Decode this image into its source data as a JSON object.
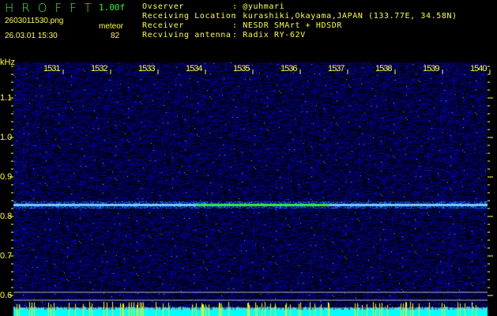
{
  "header": {
    "logo": "HROFFT",
    "version": "1.00f",
    "filename": "260301153 0.png",
    "datetime": "26.03.01 15:30",
    "event_label": "meteor",
    "event_count": "82"
  },
  "info": [
    {
      "label": "Ovserver",
      "value": ": @yuhmari"
    },
    {
      "label": "Receiving Location",
      "value": ": kurashiki,Okayama,JAPAN (133.77E, 34.58N)"
    },
    {
      "label": "Receiver",
      "value": ": NESDR SMArt + HDSDR"
    },
    {
      "label": "Recviving antenna",
      "value": ": Radix RY-62V"
    }
  ],
  "chart_data": {
    "type": "heatmap",
    "ylabel": "kHz",
    "x_ticks": [
      "1531",
      "1532",
      "1533",
      "1534",
      "1535",
      "1536",
      "1537",
      "1538",
      "1539",
      "1540"
    ],
    "y_ticks": [
      "1.1",
      "1.0",
      "0.9",
      "0.8",
      "0.7",
      "0.6"
    ],
    "ylim": [
      0.59,
      1.19
    ],
    "signal_khz": 0.83,
    "colors": {
      "text": "#ffff33",
      "signal": "#33ff66",
      "noise": "#1a2aff",
      "bottom": "#00ffff"
    }
  }
}
